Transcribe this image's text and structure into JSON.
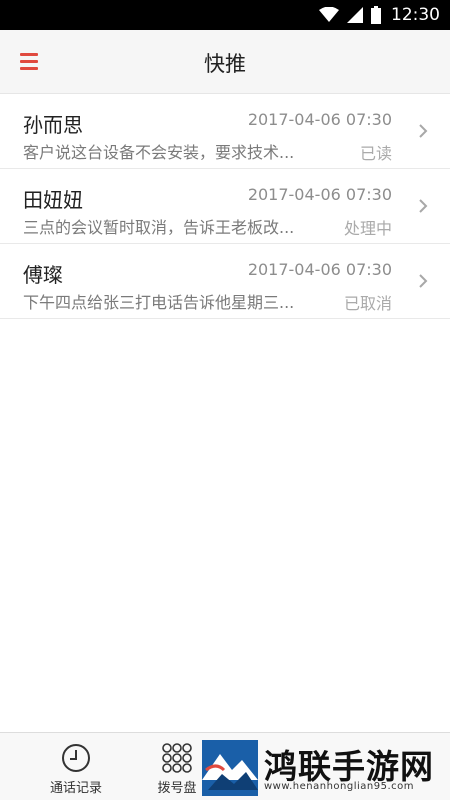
{
  "status_bar": {
    "time": "12:30",
    "icons": [
      "wifi-icon",
      "signal-icon",
      "battery-icon"
    ]
  },
  "header": {
    "title": "快推",
    "menu_icon": "menu-icon",
    "accent_color": "#e04a3f"
  },
  "items": [
    {
      "name": "孙而思",
      "time": "2017-04-06 07:30",
      "message": "客户说这台设备不会安装，要求技术...",
      "status": "已读"
    },
    {
      "name": "田妞妞",
      "time": "2017-04-06 07:30",
      "message": "三点的会议暂时取消，告诉王老板改...",
      "status": "处理中"
    },
    {
      "name": "傅璨",
      "time": "2017-04-06 07:30",
      "message": "下午四点给张三打电话告诉他星期三...",
      "status": "已取消"
    }
  ],
  "bottom_nav": {
    "tabs": [
      {
        "label": "通话记录",
        "icon": "clock-icon"
      },
      {
        "label": "拨号盘",
        "icon": "dialpad-icon"
      }
    ]
  },
  "watermark": {
    "title": "鸿联手游网",
    "url": "www.henanhonglian95.com"
  }
}
